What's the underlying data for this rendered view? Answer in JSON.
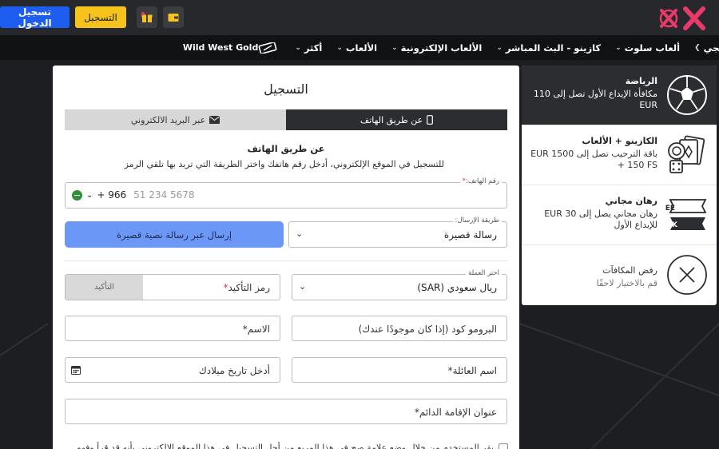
{
  "header": {
    "login_label": "تسجيل الدخول",
    "register_label": "التسجيل"
  },
  "nav": {
    "items": [
      {
        "label": "ويجي"
      },
      {
        "label": "ألعاب سلوت"
      },
      {
        "label": "كازينو - البث المباشر"
      },
      {
        "label": "الألعاب الإلكترونية"
      },
      {
        "label": "الألعاب"
      },
      {
        "label": "أكثر"
      }
    ],
    "brand_label": "Wild West Gold"
  },
  "form": {
    "title": "التسجيل",
    "tab_phone": "عن طريق الهاتف",
    "tab_email": "عبر البريد الالكتروني",
    "subhead": "عن طريق الهاتف",
    "instructions": "للتسجيل في الموقع الإلكتروني، أدخل رقم هاتفك واختر الطريقة التي تريد بها تلقي الرمز",
    "phone_label": "رقم الهاتف:",
    "phone_code": "+ 966",
    "phone_placeholder": "51 234 5678",
    "method_label": "طريقة الإرسال:",
    "method_value": "رسالة قصيرة",
    "sms_button": "إرسال عبر رسالة نصية قصيرة",
    "currency_label": "اختر العملة",
    "currency_value": "ريال سعودي (SAR)",
    "code_placeholder": "رمز التأكيد",
    "code_confirm": "التأكيد",
    "promo_placeholder": "البرومو كود (إذا كان موجودًا عندك)",
    "name_placeholder": "الاسم",
    "surname_placeholder": "اسم العائلة",
    "dob_placeholder": "أدخل تاريخ ميلادك",
    "address_placeholder": "عنوان الإقامة الدائم",
    "required_mark": "*",
    "terms_text": "يقر المستخدم من خلال وضع علامة صح في هذا المربع من أجل التسجيل في هذا الموقع الإلكتروني بأنه قد قرأ وفهم"
  },
  "bonuses": [
    {
      "title": "الرياضة",
      "desc": "مكافأة الإيداع الأول تصل إلى 110 EUR",
      "icon": "soccer-ball-icon"
    },
    {
      "title": "الكازينو + الألعاب",
      "desc": "باقة الترحيب تصل إلى EUR 1500 + 150 FS",
      "icon": "casino-chips-cards-icon"
    },
    {
      "title": "رهان مجاني",
      "desc": "رهان مجاني يصل إلى EUR 30 للإيداع الأول",
      "icon": "free-risk-ticket-icon"
    },
    {
      "title": "رفض المكافآت",
      "desc": "قم بالاختيار لاحقًا",
      "icon": "close-circle-icon"
    }
  ],
  "colors": {
    "login_button": "#1d5ef0",
    "register_button": "#f6c21c",
    "sms_button": "#6b97f7",
    "logo_pink": "#e8396b",
    "dark": "#2b2d31"
  }
}
